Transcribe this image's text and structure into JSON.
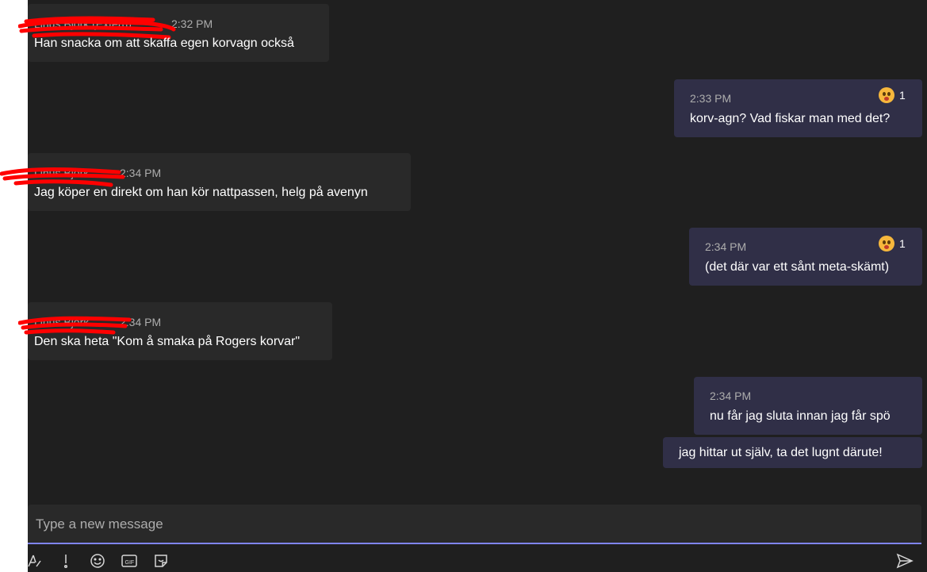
{
  "messages": [
    {
      "direction": "incoming",
      "author": "Linus Björk (Extern)",
      "time": "2:32 PM",
      "text": "Han snacka om att skaffa egen korvagn också"
    },
    {
      "direction": "outgoing",
      "time": "2:33 PM",
      "text": "korv-agn? Vad fiskar man med det?",
      "reaction": {
        "icon": "surprised-emoji-icon",
        "count": "1"
      }
    },
    {
      "direction": "incoming",
      "author": "Linus Björk",
      "time": "2:34 PM",
      "text": "Jag köper en direkt om han kör nattpassen, helg på avenyn"
    },
    {
      "direction": "outgoing",
      "time": "2:34 PM",
      "text": "(det där var ett sånt meta-skämt)",
      "reaction": {
        "icon": "surprised-emoji-icon",
        "count": "1"
      }
    },
    {
      "direction": "incoming",
      "author": "Linus Björk",
      "time": "2:34 PM",
      "text": "Den ska heta \"Kom å smaka på Rogers korvar\""
    },
    {
      "direction": "outgoing",
      "time": "2:34 PM",
      "text": "nu får jag sluta innan jag får spö"
    },
    {
      "direction": "outgoing",
      "time": "",
      "text": "jag hittar ut själv, ta det lugnt därute!"
    }
  ],
  "composer": {
    "placeholder": "Type a new message",
    "value": ""
  },
  "toolbar": [
    "format-icon",
    "important-icon",
    "emoji-icon",
    "gif-icon",
    "sticker-icon",
    "send-icon"
  ],
  "colors": {
    "background": "#1f1f1f",
    "incoming_bubble": "#292929",
    "outgoing_bubble": "#302f47",
    "accent": "#7f85f5",
    "redaction": "#ff0000"
  }
}
